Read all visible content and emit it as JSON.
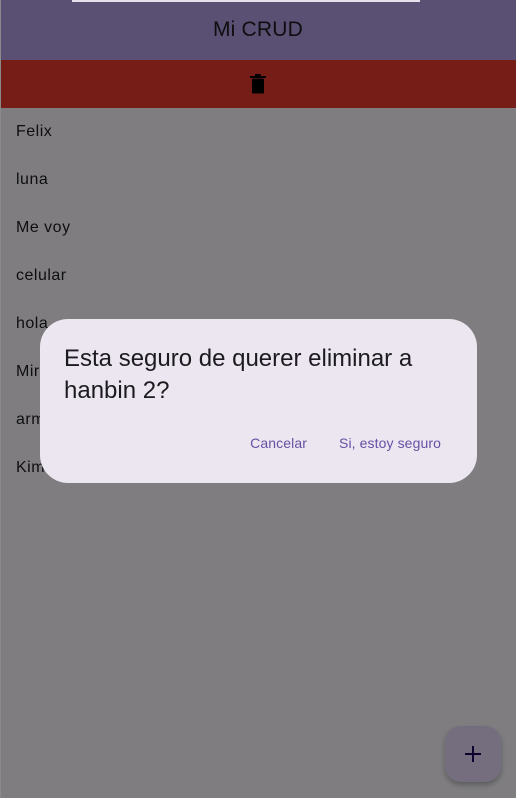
{
  "app_bar": {
    "title": "Mi CRUD"
  },
  "delete_bar": {
    "icon": "trash-icon",
    "color": "#ef3a2f"
  },
  "list": {
    "items": [
      "Felix",
      "luna",
      "Me voy",
      "celular",
      "hola",
      "Mir",
      "arm",
      "Kim"
    ]
  },
  "dialog": {
    "message": "Esta seguro de querer eliminar a hanbin 2?",
    "cancel_label": "Cancelar",
    "confirm_label": "Si, estoy seguro"
  },
  "fab": {
    "icon": "plus-icon"
  },
  "colors": {
    "app_bar": "#b3a0e6",
    "accent": "#6750a4",
    "dialog_surface": "#ece6f0",
    "fab": "#eaddff"
  }
}
